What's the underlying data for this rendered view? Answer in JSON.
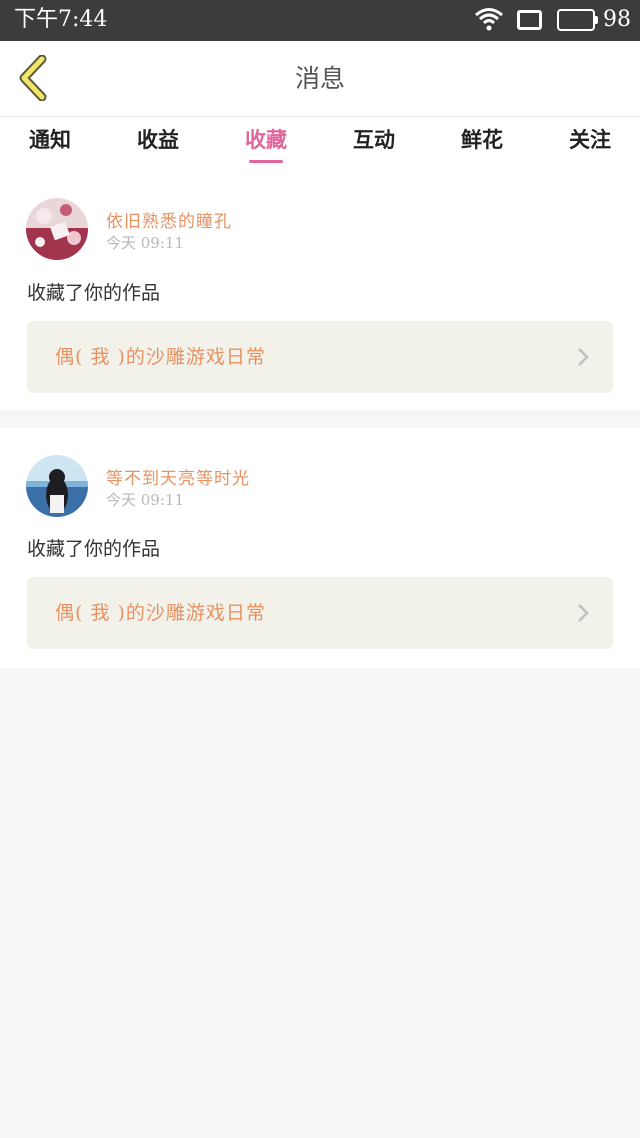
{
  "status_bar": {
    "time": "下午7:44",
    "battery_level": "98",
    "icons": [
      "wifi-icon",
      "screen-icon",
      "battery-icon"
    ]
  },
  "header": {
    "title": "消息",
    "back_icon": "chevron-left-icon"
  },
  "tabs": [
    {
      "label": "通知",
      "active": false
    },
    {
      "label": "收益",
      "active": false
    },
    {
      "label": "收藏",
      "active": true
    },
    {
      "label": "互动",
      "active": false
    },
    {
      "label": "鲜花",
      "active": false
    },
    {
      "label": "关注",
      "active": false
    }
  ],
  "messages": [
    {
      "username": "依旧熟悉的瞳孔",
      "time": "今天  09:11",
      "action": "收藏了你的作品",
      "work_title": "偶( 我 )的沙雕游戏日常"
    },
    {
      "username": "等不到天亮等时光",
      "time": "今天  09:11",
      "action": "收藏了你的作品",
      "work_title": "偶( 我 )的沙雕游戏日常"
    }
  ],
  "colors": {
    "accent": "#e0679b",
    "username": "#e79263",
    "status_bar": "#3c3c3c",
    "work_box": "#f2f2ea"
  }
}
